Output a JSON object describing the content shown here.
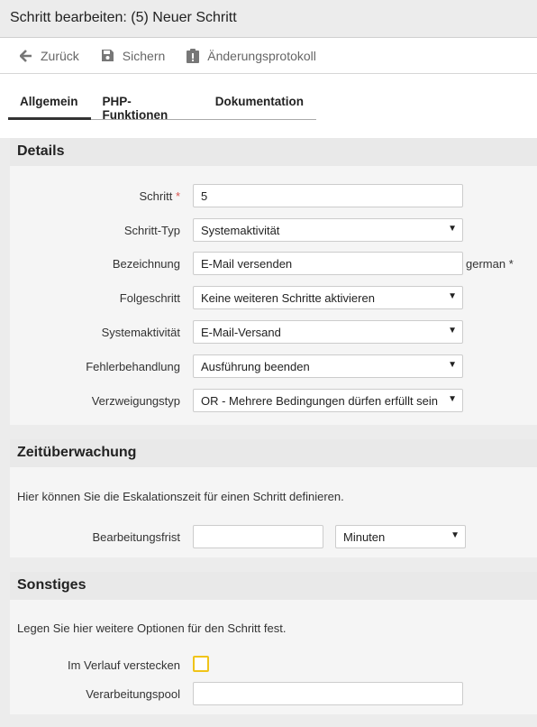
{
  "window": {
    "title": "Schritt bearbeiten: (5) Neuer Schritt"
  },
  "toolbar": {
    "back_label": "Zurück",
    "save_label": "Sichern",
    "changelog_label": "Änderungsprotokoll"
  },
  "tabs": [
    {
      "label": "Allgemein",
      "active": true
    },
    {
      "label": "PHP-Funktionen",
      "active": false
    },
    {
      "label": "Dokumentation",
      "active": false
    }
  ],
  "details": {
    "heading": "Details",
    "schritt": {
      "label": "Schritt",
      "required_mark": "*",
      "value": "5"
    },
    "schritt_typ": {
      "label": "Schritt-Typ",
      "value": "Systemaktivität"
    },
    "bezeichnung": {
      "label": "Bezeichnung",
      "value": "E-Mail versenden",
      "suffix": "german *"
    },
    "folgeschritt": {
      "label": "Folgeschritt",
      "value": "Keine weiteren Schritte aktivieren"
    },
    "systemaktivitaet": {
      "label": "Systemaktivität",
      "value": "E-Mail-Versand"
    },
    "fehlerbehandlung": {
      "label": "Fehlerbehandlung",
      "value": "Ausführung beenden"
    },
    "verzweigungstyp": {
      "label": "Verzweigungstyp",
      "value": "OR - Mehrere Bedingungen dürfen erfüllt sein"
    }
  },
  "zeitueberwachung": {
    "heading": "Zeitüberwachung",
    "description": "Hier können Sie die Eskalationszeit für einen Schritt definieren.",
    "bearbeitungsfrist": {
      "label": "Bearbeitungsfrist",
      "value": "",
      "unit": "Minuten"
    }
  },
  "sonstiges": {
    "heading": "Sonstiges",
    "description": "Legen Sie hier weitere Optionen für den Schritt fest.",
    "im_verlauf": {
      "label": "Im Verlauf verstecken",
      "checked": false
    },
    "verarbeitungspool": {
      "label": "Verarbeitungspool",
      "value": ""
    }
  },
  "colors": {
    "checkbox_border": "#f0c419",
    "required": "#d9534f"
  }
}
